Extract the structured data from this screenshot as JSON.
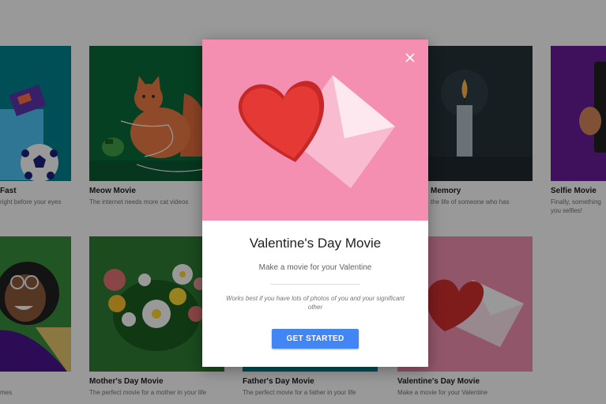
{
  "cards": [
    {
      "title": "Fast",
      "subtitle": "right before your eyes"
    },
    {
      "title": "Meow Movie",
      "subtitle": "The internet needs more cat videos"
    },
    {
      "title": "Memory",
      "subtitle": "the life of someone who has"
    },
    {
      "title": "Selfie Movie",
      "subtitle": "Finally, something you selfies!"
    },
    {
      "title": "",
      "subtitle": "mes"
    },
    {
      "title": "Mother's Day Movie",
      "subtitle": "The perfect movie for a mother in your life"
    },
    {
      "title": "Father's Day Movie",
      "subtitle": "The perfect movie for a father in your life"
    },
    {
      "title": "Valentine's Day Movie",
      "subtitle": "Make a movie for your Valentine"
    }
  ],
  "modal": {
    "title": "Valentine's Day Movie",
    "subtitle": "Make a movie for your Valentine",
    "note": "Works best if you have lots of photos of you and your significant other",
    "cta_label": "GET STARTED",
    "close_icon": "close-icon"
  },
  "colors": {
    "hero_pink": "#f48fb1",
    "heart_red": "#e53935",
    "button_blue": "#4285f4"
  }
}
